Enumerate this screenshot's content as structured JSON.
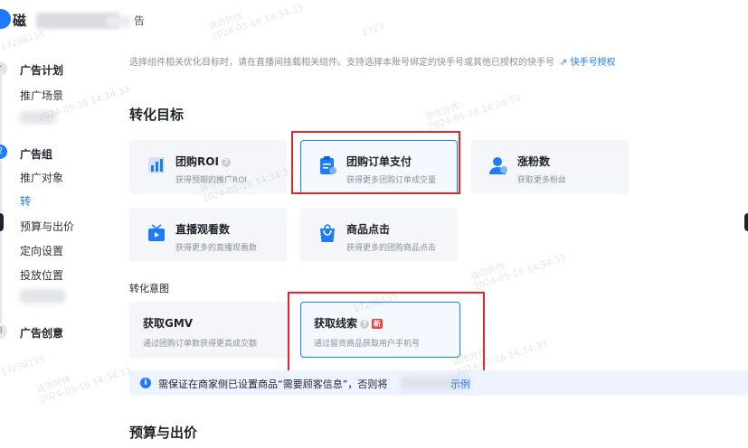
{
  "header": {
    "brand_text": "磁",
    "brand_tail": "告"
  },
  "sidebar": {
    "steps": [
      {
        "title": "广告计划",
        "marker": "✓",
        "items": [
          "推广场景"
        ]
      },
      {
        "title": "广告组",
        "marker": "2",
        "items": [
          "推广对象",
          "转",
          "预算与出价",
          "定向设置",
          "投放位置"
        ]
      },
      {
        "title": "广告创意",
        "marker": "3",
        "items": []
      }
    ]
  },
  "hint": {
    "text": "选择组件相关优化目标时，请在直播间挂载相关组件。支持选择本账号绑定的快手号或其他已授权的快手号",
    "link": "快手号授权"
  },
  "conversion_target": {
    "title": "转化目标",
    "cards": [
      {
        "title": "团购ROI",
        "desc": "获得预期的推广ROI",
        "help": "?",
        "icon": "bar-chart-icon"
      },
      {
        "title": "团购订单支付",
        "desc": "获得更多团购订单成交量",
        "icon": "order-clipboard-icon"
      },
      {
        "title": "涨粉数",
        "desc": "获取更多粉丝",
        "icon": "user-icon"
      },
      {
        "title": "直播观看数",
        "desc": "获得更多的直播观看数",
        "icon": "tv-play-icon"
      },
      {
        "title": "商品点击",
        "desc": "获得更多的团购商品点击",
        "icon": "shopping-bag-icon"
      }
    ]
  },
  "conversion_intent": {
    "title": "转化意图",
    "options": [
      {
        "title": "获取GMV",
        "desc": "通过团购订单数获得更高成交额"
      },
      {
        "title": "获取线索",
        "desc": "通过留资商品获取用户手机号",
        "help": "?",
        "badge": "新"
      }
    ]
  },
  "notice": {
    "icon": "i",
    "text": "需保证在商家侧已设置商品“需要顾客信息”，否则将",
    "link": "示例"
  },
  "budget": {
    "title": "预算与出价"
  },
  "watermark": {
    "id": "17238135",
    "id_short": "1723",
    "date": "2024-05-16 14:34:33",
    "notice": "请勿外传"
  },
  "colors": {
    "accent": "#1e7bff",
    "highlight": "#e8232b"
  }
}
